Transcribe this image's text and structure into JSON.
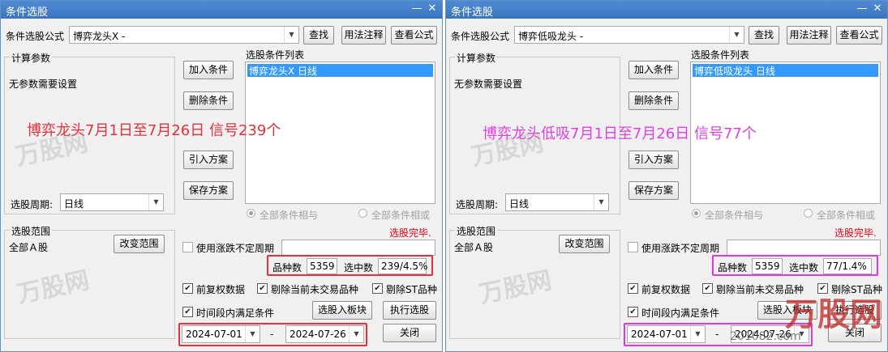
{
  "windows": [
    {
      "title": "条件选股",
      "formula_label": "条件选股公式",
      "formula_value": "博弈龙头X  -",
      "buttons": {
        "find": "查找",
        "usage": "用法注释",
        "view": "查看公式",
        "add": "加入条件",
        "delete": "删除条件",
        "import": "引入方案",
        "save": "保存方案",
        "change_range": "改变范围",
        "to_block": "选股入板块",
        "run": "执行选股",
        "close": "关闭"
      },
      "params_title": "计算参数",
      "params_text": "无参数需要设置",
      "list_title": "选股条件列表",
      "list_items": [
        "博弈龙头X  日线"
      ],
      "period_label": "选股周期:",
      "period_value": "日线",
      "radio_and": "全部条件相与",
      "radio_or": "全部条件相或",
      "range_title": "选股范围",
      "range_value": "全部Ａ股",
      "status": "选股完毕.",
      "use_irregular": "使用涨跌不定周期",
      "count_label": "品种数",
      "count_value": "5359",
      "selected_label": "选中数",
      "selected_value": "239/4.5%",
      "chk_adjust": "前复权数据",
      "chk_exclude_untraded": "剔除当前未交易品种",
      "chk_exclude_st": "剔除ST品种",
      "chk_period": "时间段内满足条件",
      "date_from": "2024-07-01",
      "date_sep": "-",
      "date_to": "2024-07-26",
      "annotation": "博弈龙头7月1日至7月26日 信号239个",
      "annotation_color": "#e8303a"
    },
    {
      "title": "条件选股",
      "formula_label": "条件选股公式",
      "formula_value": "博弈低吸龙头  -",
      "buttons": {
        "find": "查找",
        "usage": "用法注释",
        "view": "查看公式",
        "add": "加入条件",
        "delete": "删除条件",
        "import": "引入方案",
        "save": "保存方案",
        "change_range": "改变范围",
        "to_block": "选股入板块",
        "run": "执行选股",
        "close": "关闭"
      },
      "params_title": "计算参数",
      "params_text": "无参数需要设置",
      "list_title": "选股条件列表",
      "list_items": [
        "博弈低吸龙头  日线"
      ],
      "period_label": "选股周期:",
      "period_value": "日线",
      "radio_and": "全部条件相与",
      "radio_or": "全部条件相或",
      "range_title": "选股范围",
      "range_value": "全部Ａ股",
      "status": "选股完毕.",
      "use_irregular": "使用涨跌不定周期",
      "count_label": "品种数",
      "count_value": "5359",
      "selected_label": "选中数",
      "selected_value": "77/1.4%",
      "chk_adjust": "前复权数据",
      "chk_exclude_untraded": "剔除当前未交易品种",
      "chk_exclude_st": "剔除ST品种",
      "chk_period": "时间段内满足条件",
      "date_from": "2024-07-01",
      "date_sep": "-",
      "date_to": "2024-07-26",
      "annotation": "博弈龙头低吸7月1日至7月26日 信号77个",
      "annotation_color": "#e040e0"
    }
  ],
  "watermark": {
    "brand": "万股网",
    "site": "201082.com"
  },
  "colors": {
    "titlebar": "#3f7cc6",
    "selection": "#3399ff",
    "status_red": "#e60012",
    "highlight_red": "#e8303a",
    "highlight_magenta": "#e038e0"
  }
}
